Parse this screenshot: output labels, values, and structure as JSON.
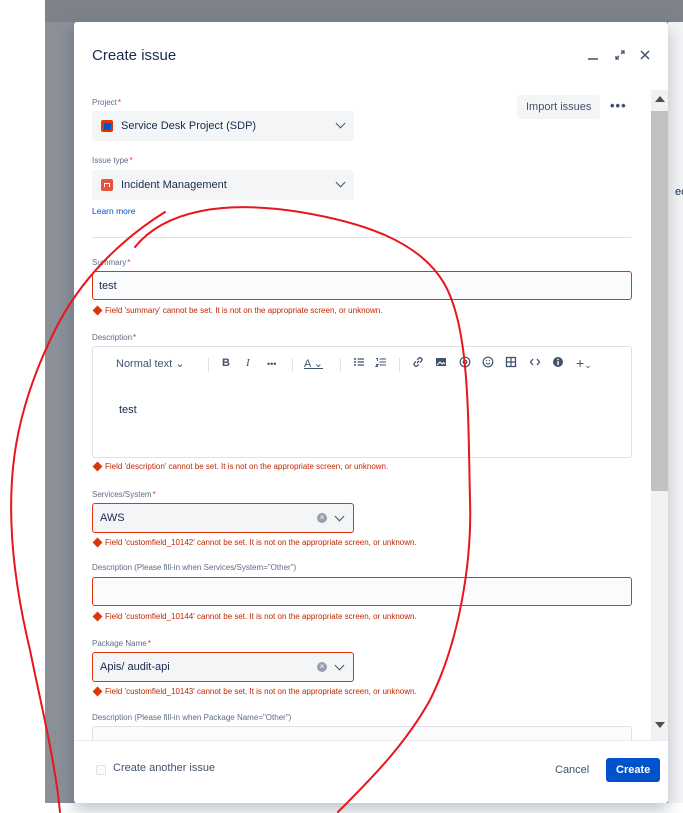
{
  "background": {
    "side_text": "ec"
  },
  "modal": {
    "title": "Create issue",
    "header_icons": [
      "minimize-icon",
      "expand-icon",
      "close-icon"
    ],
    "import_button": "Import issues",
    "more_button": "•••"
  },
  "form": {
    "project": {
      "label": "Project",
      "required": "*",
      "value": "Service Desk Project (SDP)"
    },
    "issue_type": {
      "label": "Issue type",
      "required": "*",
      "value": "Incident Management",
      "learn_more": "Learn more"
    },
    "summary": {
      "label": "Summary",
      "required": "*",
      "value": "test",
      "error": "Field 'summary' cannot be set. It is not on the appropriate screen, or unknown."
    },
    "description": {
      "label": "Description",
      "required": "*",
      "toolbar": {
        "text_style": "Normal text",
        "bold": "B",
        "italic": "I",
        "more": "•••",
        "text_color": "A"
      },
      "value": "test",
      "error": "Field 'description' cannot be set. It is not on the appropriate screen, or unknown."
    },
    "services": {
      "label": "Services/System",
      "required": "*",
      "value": "AWS",
      "error": "Field 'customfield_10142' cannot be set. It is not on the appropriate screen, or unknown."
    },
    "services_other": {
      "label": "Description (Please fill-in when Services/System=\"Other\")",
      "value": "",
      "error": "Field 'customfield_10144' cannot be set. It is not on the appropriate screen, or unknown."
    },
    "package": {
      "label": "Package Name",
      "required": "*",
      "value": "Apis/ audit-api",
      "error": "Field 'customfield_10143' cannot be set. It is not on the appropriate screen, or unknown."
    },
    "package_other": {
      "label": "Description (Please fill-in when Package Name=\"Other\")"
    }
  },
  "footer": {
    "create_another": "Create another issue",
    "cancel": "Cancel",
    "create": "Create"
  },
  "colors": {
    "primary": "#0052cc",
    "error": "#de350b",
    "annotation": "#e8161d"
  }
}
